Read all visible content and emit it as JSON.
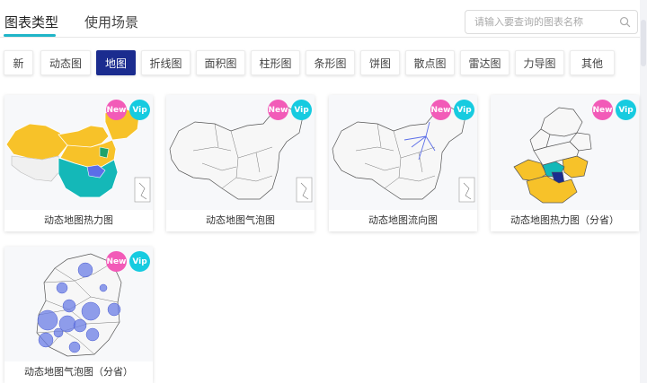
{
  "header": {
    "tabs": [
      {
        "label": "图表类型",
        "active": true
      },
      {
        "label": "使用场景",
        "active": false
      }
    ],
    "search": {
      "placeholder": "请输入要查询的图表名称",
      "value": ""
    }
  },
  "filters": [
    {
      "label": "新",
      "active": false
    },
    {
      "label": "动态图",
      "active": false
    },
    {
      "label": "地图",
      "active": true
    },
    {
      "label": "折线图",
      "active": false
    },
    {
      "label": "面积图",
      "active": false
    },
    {
      "label": "柱形图",
      "active": false
    },
    {
      "label": "条形图",
      "active": false
    },
    {
      "label": "饼图",
      "active": false
    },
    {
      "label": "散点图",
      "active": false
    },
    {
      "label": "雷达图",
      "active": false
    },
    {
      "label": "力导图",
      "active": false
    },
    {
      "label": "其他",
      "active": false
    }
  ],
  "badges": {
    "new": "New",
    "vip": "Vip"
  },
  "cards": [
    {
      "title": "动态地图热力图",
      "thumb": "china-heat-map"
    },
    {
      "title": "动态地图气泡图",
      "thumb": "china-bubble-map"
    },
    {
      "title": "动态地图流向图",
      "thumb": "china-flow-map"
    },
    {
      "title": "动态地图热力图（分省）",
      "thumb": "province-heat-map"
    },
    {
      "title": "动态地图气泡图（分省）",
      "thumb": "province-bubble-map"
    }
  ],
  "colors": {
    "accent": "#1fb5c8",
    "active_chip": "#1b2c8f",
    "new_badge": "#f25bb8",
    "vip_badge": "#16cbe0",
    "heat_yellow": "#f7c229",
    "heat_teal": "#14b8b8",
    "heat_blue": "#5b6ee8",
    "bubble": "#6b7ee6"
  }
}
